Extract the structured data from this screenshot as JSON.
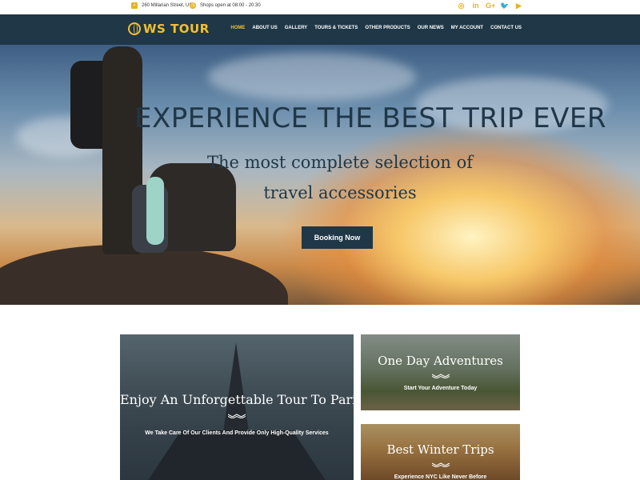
{
  "topbar": {
    "address": "260 Millarian Street, USA",
    "hours": "Shops open at 08:00 - 20:30",
    "social": [
      "instagram-icon",
      "linkedin-icon",
      "google-plus-icon",
      "twitter-icon",
      "youtube-icon"
    ],
    "social_glyphs": [
      "◎",
      "in",
      "G+",
      "🐦",
      "▶"
    ]
  },
  "nav": {
    "logo_text": "WS TOUR",
    "items": [
      "HOME",
      "ABOUT US",
      "GALLERY",
      "TOURS & TICKETS",
      "OTHER PRODUCTS",
      "OUR NEWS",
      "MY ACCOUNT",
      "CONTACT US"
    ],
    "active_index": 0
  },
  "hero": {
    "title": "EXPERIENCE THE BEST TRIP EVER",
    "subtitle_line1": "The most complete selection of",
    "subtitle_line2": "travel accessories",
    "cta": "Booking Now"
  },
  "cards": {
    "paris": {
      "title": "Enjoy An Unforgettable Tour To Paris!",
      "caption": "We Take Care Of Our Clients And Provide Only High-Quality Services"
    },
    "day": {
      "title": "One Day Adventures",
      "caption": "Start Your Adventure Today"
    },
    "winter": {
      "title": "Best Winter Trips",
      "caption": "Experience NYC Like Never Before"
    }
  },
  "colors": {
    "accent": "#f0c030",
    "navy": "#1f3747"
  }
}
